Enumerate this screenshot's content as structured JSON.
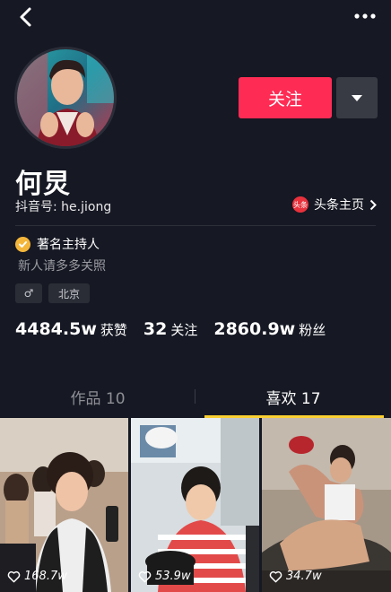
{
  "profile": {
    "name": "何炅",
    "douyin_id": "抖音号: he.jiong",
    "toutiao_badge": "头条",
    "toutiao_link": "头条主页",
    "verified_title": "著名主持人",
    "bio": "新人请多多关照",
    "gender_icon": "♂",
    "location": "北京"
  },
  "actions": {
    "follow_label": "关注"
  },
  "stats": {
    "likes_num": "4484.5w",
    "likes_label": "获赞",
    "following_num": "32",
    "following_label": "关注",
    "followers_num": "2860.9w",
    "followers_label": "粉丝"
  },
  "tabs": {
    "works": "作品 10",
    "likes": "喜欢 17",
    "active": "likes"
  },
  "videos": [
    {
      "likes": "168.7w"
    },
    {
      "likes": "53.9w"
    },
    {
      "likes": "34.7w"
    }
  ],
  "colors": {
    "background": "#161823",
    "follow_red": "#fe2c55",
    "tab_indicator": "#facf32",
    "verified_gold": "#f4b63a"
  }
}
